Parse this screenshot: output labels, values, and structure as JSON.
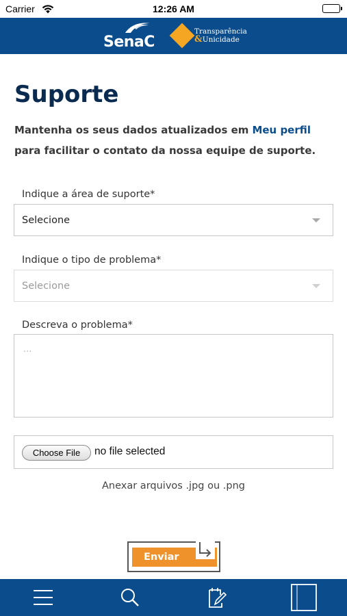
{
  "status_bar": {
    "carrier": "Carrier",
    "time": "12:26 AM"
  },
  "header": {
    "logo_senac": "SenaC",
    "logo_tu_line1": "Transparência",
    "logo_tu_amp": "&",
    "logo_tu_line2": "Unicidade"
  },
  "page": {
    "title": "Suporte",
    "intro_text": "Mantenha os seus dados atualizados em",
    "intro_link": "Meu perfil",
    "intro_text_2": "para facilitar o contato da nossa equipe de suporte."
  },
  "form": {
    "area_label": "Indique a área de suporte*",
    "area_value": "Selecione",
    "problem_type_label": "Indique o tipo de problema*",
    "problem_type_value": "Selecione",
    "description_label": "Descreva o problema*",
    "description_placeholder": "...",
    "file_button": "Choose File",
    "file_status": "no file selected",
    "file_hint": "Anexar arquivos .jpg ou .png",
    "submit": "Enviar"
  },
  "tab_bar": {
    "icons": [
      "menu-icon",
      "search-icon",
      "edit-document-icon",
      "bookmark-icon"
    ]
  },
  "colors": {
    "brand_blue": "#0b4d8c",
    "title_navy": "#0b2a4f",
    "accent_orange": "#f0922b",
    "logo_diamond": "#f5a623"
  }
}
